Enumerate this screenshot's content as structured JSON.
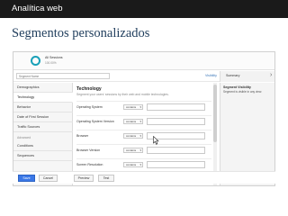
{
  "app": {
    "title": "Analítica web"
  },
  "page": {
    "title": "Segmentos personalizados"
  },
  "segment": {
    "name": "All Sessions",
    "subtitle": "100.00%",
    "name_input_placeholder": "Segment Name"
  },
  "header": {
    "visibility_label": "Visibility",
    "summary_tab": "Summary",
    "summary_chevron": "›"
  },
  "sidebar": {
    "items": [
      {
        "label": "Demographics",
        "active": false
      },
      {
        "label": "Technology",
        "active": true
      },
      {
        "label": "Behavior",
        "active": false
      },
      {
        "label": "Date of First Session",
        "active": false
      },
      {
        "label": "Traffic Sources",
        "active": false
      }
    ],
    "advanced_label": "Advanced",
    "advanced_items": [
      {
        "label": "Conditions"
      },
      {
        "label": "Sequences"
      }
    ]
  },
  "main": {
    "title": "Technology",
    "description": "Segment your users' sessions by their web and mobile technologies.",
    "rows": [
      {
        "label": "Operating System",
        "operator": "contains"
      },
      {
        "label": "Operating System Version",
        "operator": "contains"
      },
      {
        "label": "Browser",
        "operator": "contains"
      },
      {
        "label": "Browser Version",
        "operator": "contains"
      },
      {
        "label": "Screen Resolution",
        "operator": "contains"
      }
    ]
  },
  "summary": {
    "title": "Segment Visibility",
    "text": "Segment is visible in any view."
  },
  "footer": {
    "save": "Save",
    "cancel": "Cancel",
    "preview": "Preview",
    "test": "Test"
  },
  "colors": {
    "topbar": "#1a1a1a",
    "title": "#1f3d5c",
    "accent": "#19a0b8",
    "save_button": "#3b78e7",
    "link": "#3b78b8"
  },
  "icons": {
    "segment": "segment-circle-icon",
    "dropdown": "caret-down-icon",
    "cursor": "mouse-pointer-icon",
    "summary": "chevron-right-icon"
  }
}
